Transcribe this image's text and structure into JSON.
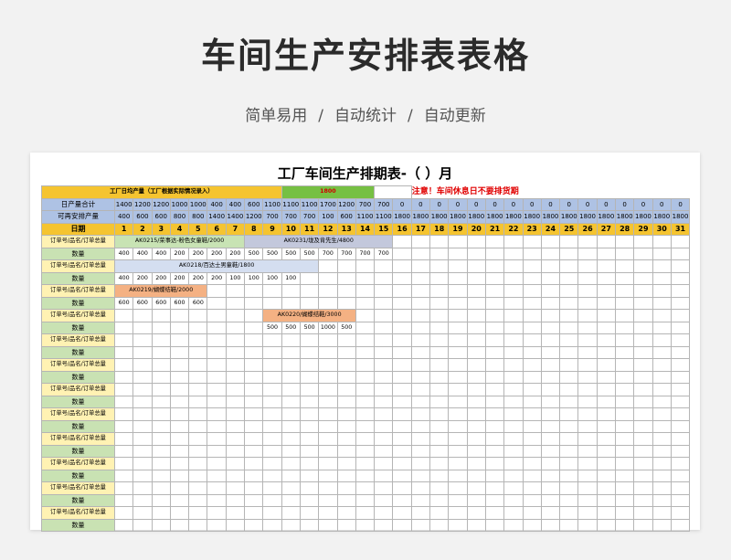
{
  "header": {
    "title": "车间生产安排表表格",
    "tags": [
      "简单易用",
      "自动统计",
      "自动更新"
    ],
    "separator": "/"
  },
  "sheet": {
    "title": "工厂车间生产排期表-（    ）月",
    "daily_label": "工厂日均产量（工厂根据实际情况录入）",
    "daily_value": "1800",
    "warning": "注意！车间休息日不要排货期",
    "row_total_label": "日产量合计",
    "row_remain_label": "可再安排产量",
    "row_day_label": "日期",
    "order_label": "订单号/品名/订单总量",
    "qty_label": "数量",
    "totals": [
      "1400",
      "1200",
      "1200",
      "1000",
      "1000",
      "400",
      "400",
      "600",
      "1100",
      "1100",
      "1100",
      "1700",
      "1200",
      "700",
      "700",
      "0",
      "0",
      "0",
      "0",
      "0",
      "0",
      "0",
      "0",
      "0",
      "0",
      "0",
      "0",
      "0",
      "0",
      "0",
      "0"
    ],
    "remain": [
      "400",
      "600",
      "600",
      "800",
      "800",
      "1400",
      "1400",
      "1200",
      "700",
      "700",
      "700",
      "100",
      "600",
      "1100",
      "1100",
      "1800",
      "1800",
      "1800",
      "1800",
      "1800",
      "1800",
      "1800",
      "1800",
      "1800",
      "1800",
      "1800",
      "1800",
      "1800",
      "1800",
      "1800",
      "1800"
    ],
    "days": [
      "1",
      "2",
      "3",
      "4",
      "5",
      "6",
      "7",
      "8",
      "9",
      "10",
      "11",
      "12",
      "13",
      "14",
      "15",
      "16",
      "17",
      "18",
      "19",
      "20",
      "21",
      "22",
      "23",
      "24",
      "25",
      "26",
      "27",
      "28",
      "29",
      "30",
      "31"
    ],
    "orders": [
      {
        "label": "AK0215/荣事达-粉色女童鞋/2000",
        "start": 1,
        "span": 7,
        "qty": [
          "400",
          "400",
          "400",
          "200",
          "200",
          "200",
          "200"
        ]
      },
      {
        "label": "AK0231/垅及肯先生/4800",
        "start": 8,
        "span": 8,
        "qty": [
          "500",
          "500",
          "500",
          "500",
          "700",
          "700",
          "700",
          "700"
        ]
      },
      {
        "label": "AK0218/百达士男童鞋/1800",
        "start": 1,
        "span": 11,
        "qty": [
          "400",
          "200",
          "200",
          "200",
          "200",
          "200",
          "100",
          "100",
          "100",
          "100"
        ]
      },
      {
        "label": "AK0219/蝴蝶结鞋/2000",
        "start": 1,
        "span": 5,
        "qty": [
          "600",
          "600",
          "600",
          "600",
          "600"
        ]
      },
      {
        "label": "AK0220/蝴蝶结鞋/3000",
        "start": 9,
        "span": 5,
        "qty": [
          "500",
          "500",
          "500",
          "1000",
          "500"
        ]
      }
    ]
  },
  "colors": {
    "yellow": "#f5c430",
    "green": "#76c043",
    "blue": "#aec2e4",
    "red": "#e00000"
  }
}
